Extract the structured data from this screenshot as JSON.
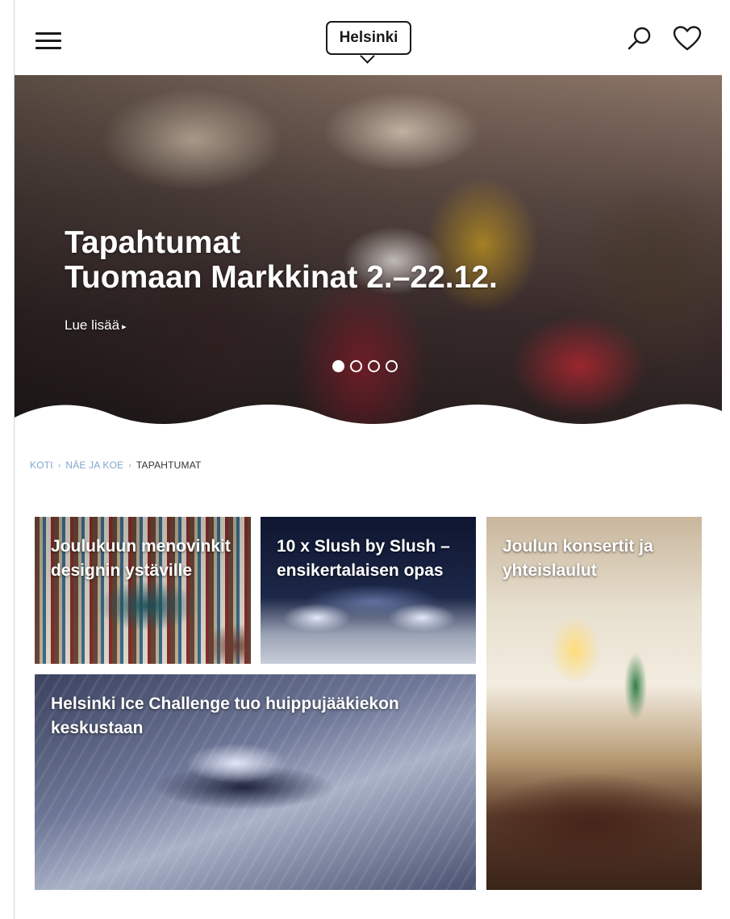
{
  "header": {
    "logo_text": "Helsinki",
    "menu_icon": "hamburger-menu-icon",
    "search_icon": "search-icon",
    "favorites_icon": "heart-icon"
  },
  "hero": {
    "category": "Tapahtumat",
    "title": "Tuomaan Markkinat 2.–22.12.",
    "link_label": "Lue lisää",
    "slides_total": 4,
    "active_slide": 1
  },
  "breadcrumb": {
    "items": [
      "KOTI",
      "NÄE JA KOE"
    ],
    "current": "TAPAHTUMAT"
  },
  "cards": [
    {
      "title": "Joulukuun menovinkit designin ystäville"
    },
    {
      "title": "10 x Slush by Slush – ensikertalaisen opas"
    },
    {
      "title": "Joulun konsertit ja yhteislaulut"
    },
    {
      "title": "Helsinki Ice Challenge tuo huippujääkiekon keskustaan"
    }
  ],
  "colors": {
    "breadcrumb_link": "#7fa6cf",
    "text_dark": "#1a1a1a"
  }
}
